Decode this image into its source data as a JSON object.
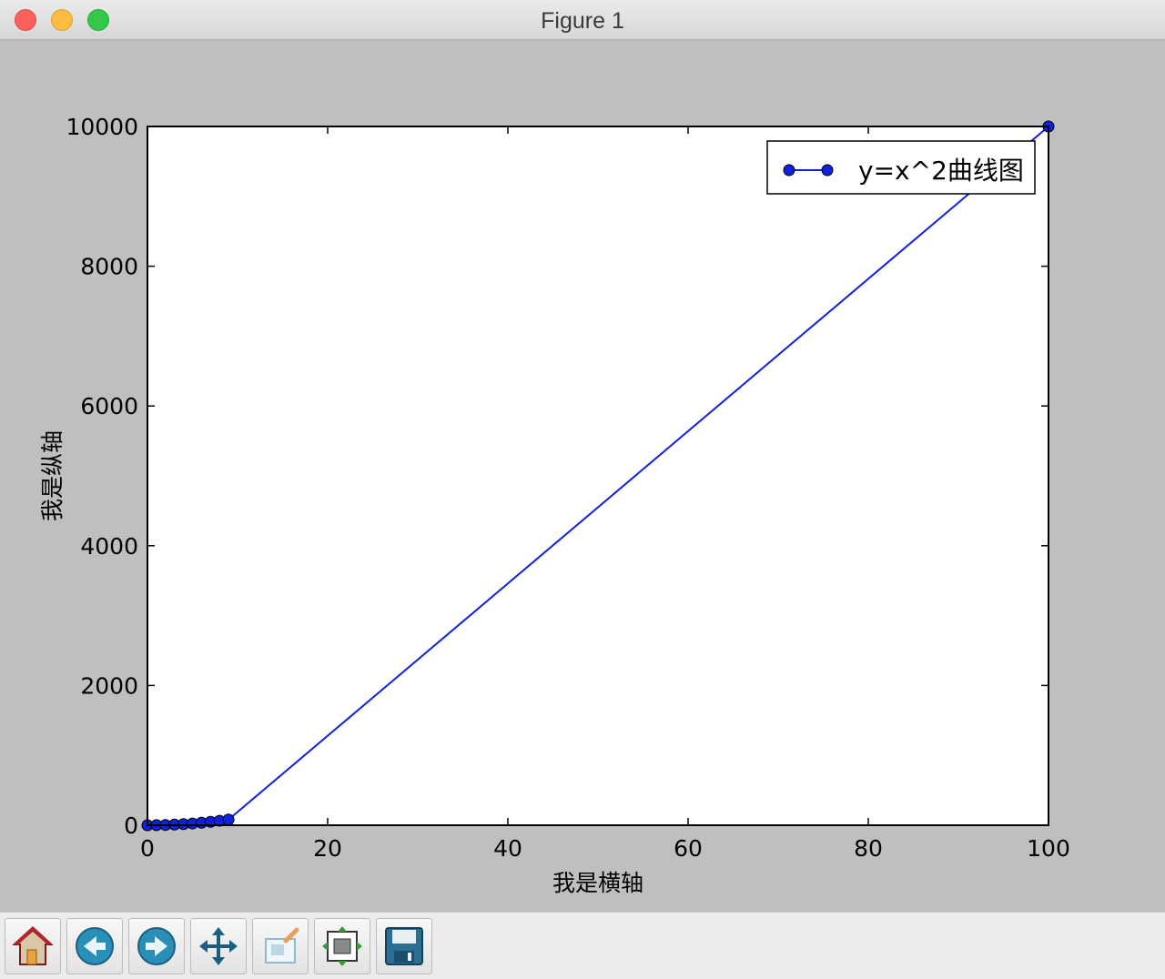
{
  "window": {
    "title": "Figure 1"
  },
  "toolbar": {
    "buttons": [
      {
        "name": "home-button",
        "icon": "home-icon"
      },
      {
        "name": "back-button",
        "icon": "back-arrow-icon"
      },
      {
        "name": "forward-button",
        "icon": "forward-arrow-icon"
      },
      {
        "name": "pan-button",
        "icon": "move-icon"
      },
      {
        "name": "zoom-button",
        "icon": "zoom-rect-icon"
      },
      {
        "name": "subplots-button",
        "icon": "subplots-icon"
      },
      {
        "name": "save-button",
        "icon": "floppy-disk-icon"
      }
    ]
  },
  "chart_data": {
    "type": "line",
    "title": "",
    "xlabel": "我是横轴",
    "ylabel": "我是纵轴",
    "xlim": [
      0,
      100
    ],
    "ylim": [
      0,
      10000
    ],
    "xticks": [
      0,
      20,
      40,
      60,
      80,
      100
    ],
    "yticks": [
      0,
      2000,
      4000,
      6000,
      8000,
      10000
    ],
    "xtick_labels": [
      "0",
      "20",
      "40",
      "60",
      "80",
      "100"
    ],
    "ytick_labels": [
      "0",
      "2000",
      "4000",
      "6000",
      "8000",
      "10000"
    ],
    "grid": false,
    "legend": {
      "placement": "top-right"
    },
    "series": [
      {
        "name": "y=x^2曲线图",
        "color": "#1020e0",
        "marker": "circle",
        "x": [
          0,
          1,
          2,
          3,
          4,
          5,
          6,
          7,
          8,
          9,
          100
        ],
        "y": [
          0,
          1,
          4,
          9,
          16,
          25,
          36,
          49,
          64,
          81,
          10000
        ]
      }
    ]
  }
}
